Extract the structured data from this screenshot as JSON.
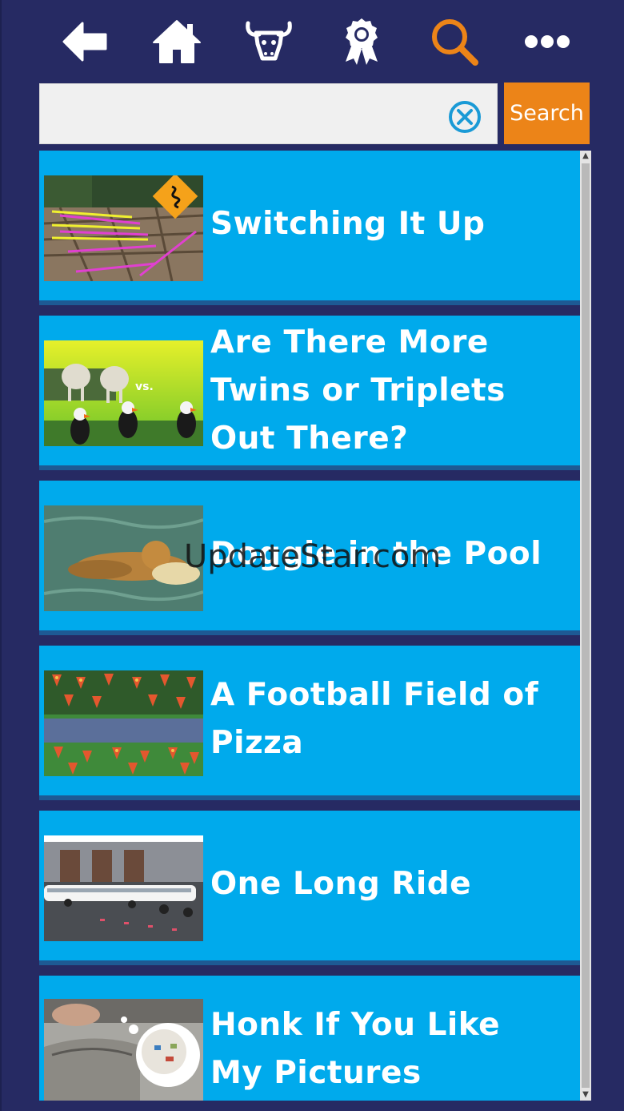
{
  "nav": {
    "items": [
      {
        "icon": "back-arrow-icon",
        "active": false
      },
      {
        "icon": "home-icon",
        "active": false
      },
      {
        "icon": "bull-icon",
        "active": false
      },
      {
        "icon": "award-ribbon-icon",
        "active": false
      },
      {
        "icon": "search-icon",
        "active": true
      },
      {
        "icon": "more-icon",
        "active": false
      }
    ]
  },
  "search": {
    "value": "",
    "placeholder": "",
    "button_label": "Search"
  },
  "colors": {
    "background": "#262a63",
    "card": "#00aaec",
    "accent": "#ec8418",
    "clear_icon": "#1a9ad6"
  },
  "stories": [
    {
      "title": "Switching It Up",
      "thumbnail": "winding-road-arrows"
    },
    {
      "title": "Are There More Twins or Triplets Out There?",
      "thumbnail": "sheep-vs-puffins"
    },
    {
      "title": "Doggie in the Pool",
      "thumbnail": "dog-swimming"
    },
    {
      "title": "A Football Field of Pizza",
      "thumbnail": "pizza-field"
    },
    {
      "title": "One Long Ride",
      "thumbnail": "long-limousine"
    },
    {
      "title": "Honk If You Like My Pictures",
      "thumbnail": "dusty-car"
    }
  ],
  "watermark": "UpdateStar.com",
  "scrollbar": {
    "up_arrow": "▲",
    "down_arrow": "▼"
  }
}
